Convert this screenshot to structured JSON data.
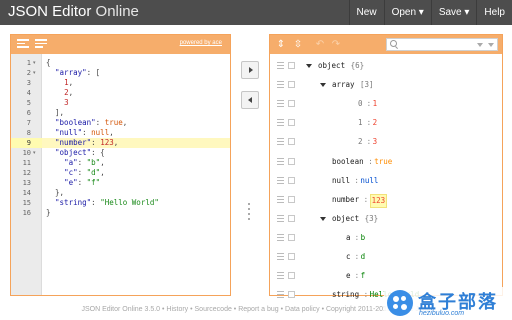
{
  "app": {
    "title_main": "JSON Editor",
    "title_sub": " Online"
  },
  "menu": [
    {
      "label": "New"
    },
    {
      "label": "Open ▾"
    },
    {
      "label": "Save ▾"
    },
    {
      "label": "Help"
    }
  ],
  "left_panel": {
    "powered_by": "powered by ace",
    "line_numbers": [
      "1",
      "2",
      "3",
      "4",
      "5",
      "6",
      "7",
      "8",
      "9",
      "10",
      "11",
      "12",
      "13",
      "14",
      "15",
      "16"
    ],
    "active_line": 9,
    "fold_lines": [
      1,
      2,
      10
    ]
  },
  "code_lines": [
    [
      [
        "p",
        "{"
      ]
    ],
    [
      [
        "p",
        "  "
      ],
      [
        "k",
        "\"array\""
      ],
      [
        "p",
        ": ["
      ]
    ],
    [
      [
        "p",
        "    "
      ],
      [
        "n",
        "1"
      ],
      [
        "p",
        ","
      ]
    ],
    [
      [
        "p",
        "    "
      ],
      [
        "n",
        "2"
      ],
      [
        "p",
        ","
      ]
    ],
    [
      [
        "p",
        "    "
      ],
      [
        "n",
        "3"
      ]
    ],
    [
      [
        "p",
        "  ],"
      ]
    ],
    [
      [
        "p",
        "  "
      ],
      [
        "k",
        "\"boolean\""
      ],
      [
        "p",
        ": "
      ],
      [
        "b",
        "true"
      ],
      [
        "p",
        ","
      ]
    ],
    [
      [
        "p",
        "  "
      ],
      [
        "k",
        "\"null\""
      ],
      [
        "p",
        ": "
      ],
      [
        "b",
        "null"
      ],
      [
        "p",
        ","
      ]
    ],
    [
      [
        "p",
        "  "
      ],
      [
        "k",
        "\"number\""
      ],
      [
        "p",
        ": "
      ],
      [
        "n",
        "123"
      ],
      [
        "p",
        ","
      ]
    ],
    [
      [
        "p",
        "  "
      ],
      [
        "k",
        "\"object\""
      ],
      [
        "p",
        ": {"
      ]
    ],
    [
      [
        "p",
        "    "
      ],
      [
        "k",
        "\"a\""
      ],
      [
        "p",
        ": "
      ],
      [
        "s",
        "\"b\""
      ],
      [
        "p",
        ","
      ]
    ],
    [
      [
        "p",
        "    "
      ],
      [
        "k",
        "\"c\""
      ],
      [
        "p",
        ": "
      ],
      [
        "s",
        "\"d\""
      ],
      [
        "p",
        ","
      ]
    ],
    [
      [
        "p",
        "    "
      ],
      [
        "k",
        "\"e\""
      ],
      [
        "p",
        ": "
      ],
      [
        "s",
        "\"f\""
      ]
    ],
    [
      [
        "p",
        "  },"
      ]
    ],
    [
      [
        "p",
        "  "
      ],
      [
        "k",
        "\"string\""
      ],
      [
        "p",
        ": "
      ],
      [
        "s",
        "\"Hello World\""
      ]
    ],
    [
      [
        "p",
        "}"
      ]
    ]
  ],
  "tree": {
    "rows": [
      {
        "depth": 0,
        "expand": true,
        "field": "object",
        "sep": "",
        "value": "{6}",
        "type": "obj"
      },
      {
        "depth": 1,
        "expand": true,
        "field": "array",
        "sep": "",
        "value": "[3]",
        "type": "obj"
      },
      {
        "depth": 2,
        "expand": false,
        "index": "0",
        "sep": ":",
        "value": "1",
        "type": "num"
      },
      {
        "depth": 2,
        "expand": false,
        "index": "1",
        "sep": ":",
        "value": "2",
        "type": "num"
      },
      {
        "depth": 2,
        "expand": false,
        "index": "2",
        "sep": ":",
        "value": "3",
        "type": "num"
      },
      {
        "depth": 1,
        "expand": false,
        "field": "boolean",
        "sep": ":",
        "value": "true",
        "type": "bool"
      },
      {
        "depth": 1,
        "expand": false,
        "field": "null",
        "sep": ":",
        "value": "null",
        "type": "null"
      },
      {
        "depth": 1,
        "expand": false,
        "field": "number",
        "sep": ":",
        "value": "123",
        "type": "num",
        "highlight": true
      },
      {
        "depth": 1,
        "expand": true,
        "field": "object",
        "sep": "",
        "value": "{3}",
        "type": "obj"
      },
      {
        "depth": 2,
        "expand": false,
        "field": "a",
        "sep": ":",
        "value": "b",
        "type": "str"
      },
      {
        "depth": 2,
        "expand": false,
        "field": "c",
        "sep": ":",
        "value": "d",
        "type": "str"
      },
      {
        "depth": 2,
        "expand": false,
        "field": "e",
        "sep": ":",
        "value": "f",
        "type": "str"
      },
      {
        "depth": 1,
        "expand": false,
        "field": "string",
        "sep": ":",
        "value": "Hello World",
        "type": "str"
      }
    ]
  },
  "footer": {
    "text": "JSON Editor Online 3.5.0 • History • Sourcecode • Report a bug • Data policy • Copyright 2011-2015 Jos de Jong"
  },
  "watermark": {
    "title": "盒子部落",
    "url": "hezibuluo.com"
  },
  "colors": {
    "accent": "#f6ad6b",
    "header": "#4d4d4d"
  }
}
